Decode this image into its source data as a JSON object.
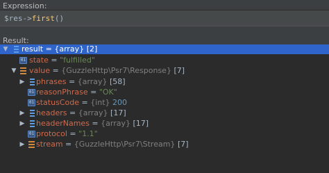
{
  "expression_label": "Expression:",
  "expression": {
    "var": "$res",
    "arrow": "->",
    "fn": "first",
    "parens": "()"
  },
  "result_label": "Result:",
  "tree": [
    {
      "name": "result",
      "type": "{array}",
      "extra": "[2]"
    },
    {
      "name": "state",
      "value": "\"fulfilled\""
    },
    {
      "name": "value",
      "type": "{GuzzleHttp\\Psr7\\Response}",
      "extra": "[7]"
    },
    {
      "name": "phrases",
      "type": "{array}",
      "extra": "[58]"
    },
    {
      "name": "reasonPhrase",
      "value": "\"OK\""
    },
    {
      "name": "statusCode",
      "type": "{int}",
      "num": "200"
    },
    {
      "name": "headers",
      "type": "{array}",
      "extra": "[17]"
    },
    {
      "name": "headerNames",
      "type": "{array}",
      "extra": "[17]"
    },
    {
      "name": "protocol",
      "value": "\"1.1\""
    },
    {
      "name": "stream",
      "type": "{GuzzleHttp\\Psr7\\Stream}",
      "extra": "[7]"
    }
  ],
  "eq": " = ",
  "icons": {
    "array": "array-icon",
    "primitive": "primitive-icon",
    "object": "object-icon"
  },
  "prim_glyph": "01",
  "arrows": {
    "expanded": "▼",
    "collapsed": "▶"
  },
  "colors": {
    "selection": "#2f65ca",
    "name": "#cf6a4c",
    "string": "#6a8759",
    "number": "#6897bb"
  }
}
